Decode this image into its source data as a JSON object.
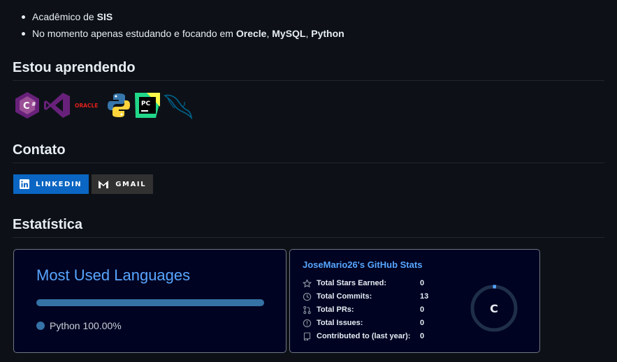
{
  "about": {
    "item1_prefix": "Acadêmico de ",
    "item1_strong": "SIS",
    "item2_prefix": "No momento apenas estudando e focando em ",
    "item2_strong1": "Orecle",
    "item2_sep1": ", ",
    "item2_strong2": "MySQL",
    "item2_sep2": ", ",
    "item2_strong3": "Python"
  },
  "learning": {
    "heading": "Estou aprendendo",
    "icons": [
      "csharp-icon",
      "visual-studio-icon",
      "oracle-icon",
      "python-icon",
      "pycharm-icon",
      "mysql-icon"
    ],
    "oracle_text": "ORACLE",
    "pycharm_text": "PC"
  },
  "contact": {
    "heading": "Contato",
    "linkedin_label": "LINKEDIN",
    "gmail_label": "GMAIL",
    "linkedin_color": "#0a66c2",
    "gmail_color": "#313131"
  },
  "stats": {
    "heading": "Estatística",
    "languages_card": {
      "title": "Most Used Languages",
      "language": "Python",
      "percent": "100.00%",
      "percent_value": 100,
      "color": "#3572a5"
    },
    "github_card": {
      "title": "JoseMario26's GitHub Stats",
      "rows": [
        {
          "label": "Total Stars Earned:",
          "value": "0",
          "icon": "star-icon"
        },
        {
          "label": "Total Commits:",
          "value": "13",
          "icon": "clock-icon"
        },
        {
          "label": "Total PRs:",
          "value": "0",
          "icon": "pull-request-icon"
        },
        {
          "label": "Total Issues:",
          "value": "0",
          "icon": "issue-icon"
        },
        {
          "label": "Contributed to (last year):",
          "value": "0",
          "icon": "repo-icon"
        }
      ],
      "grade": "C"
    }
  }
}
